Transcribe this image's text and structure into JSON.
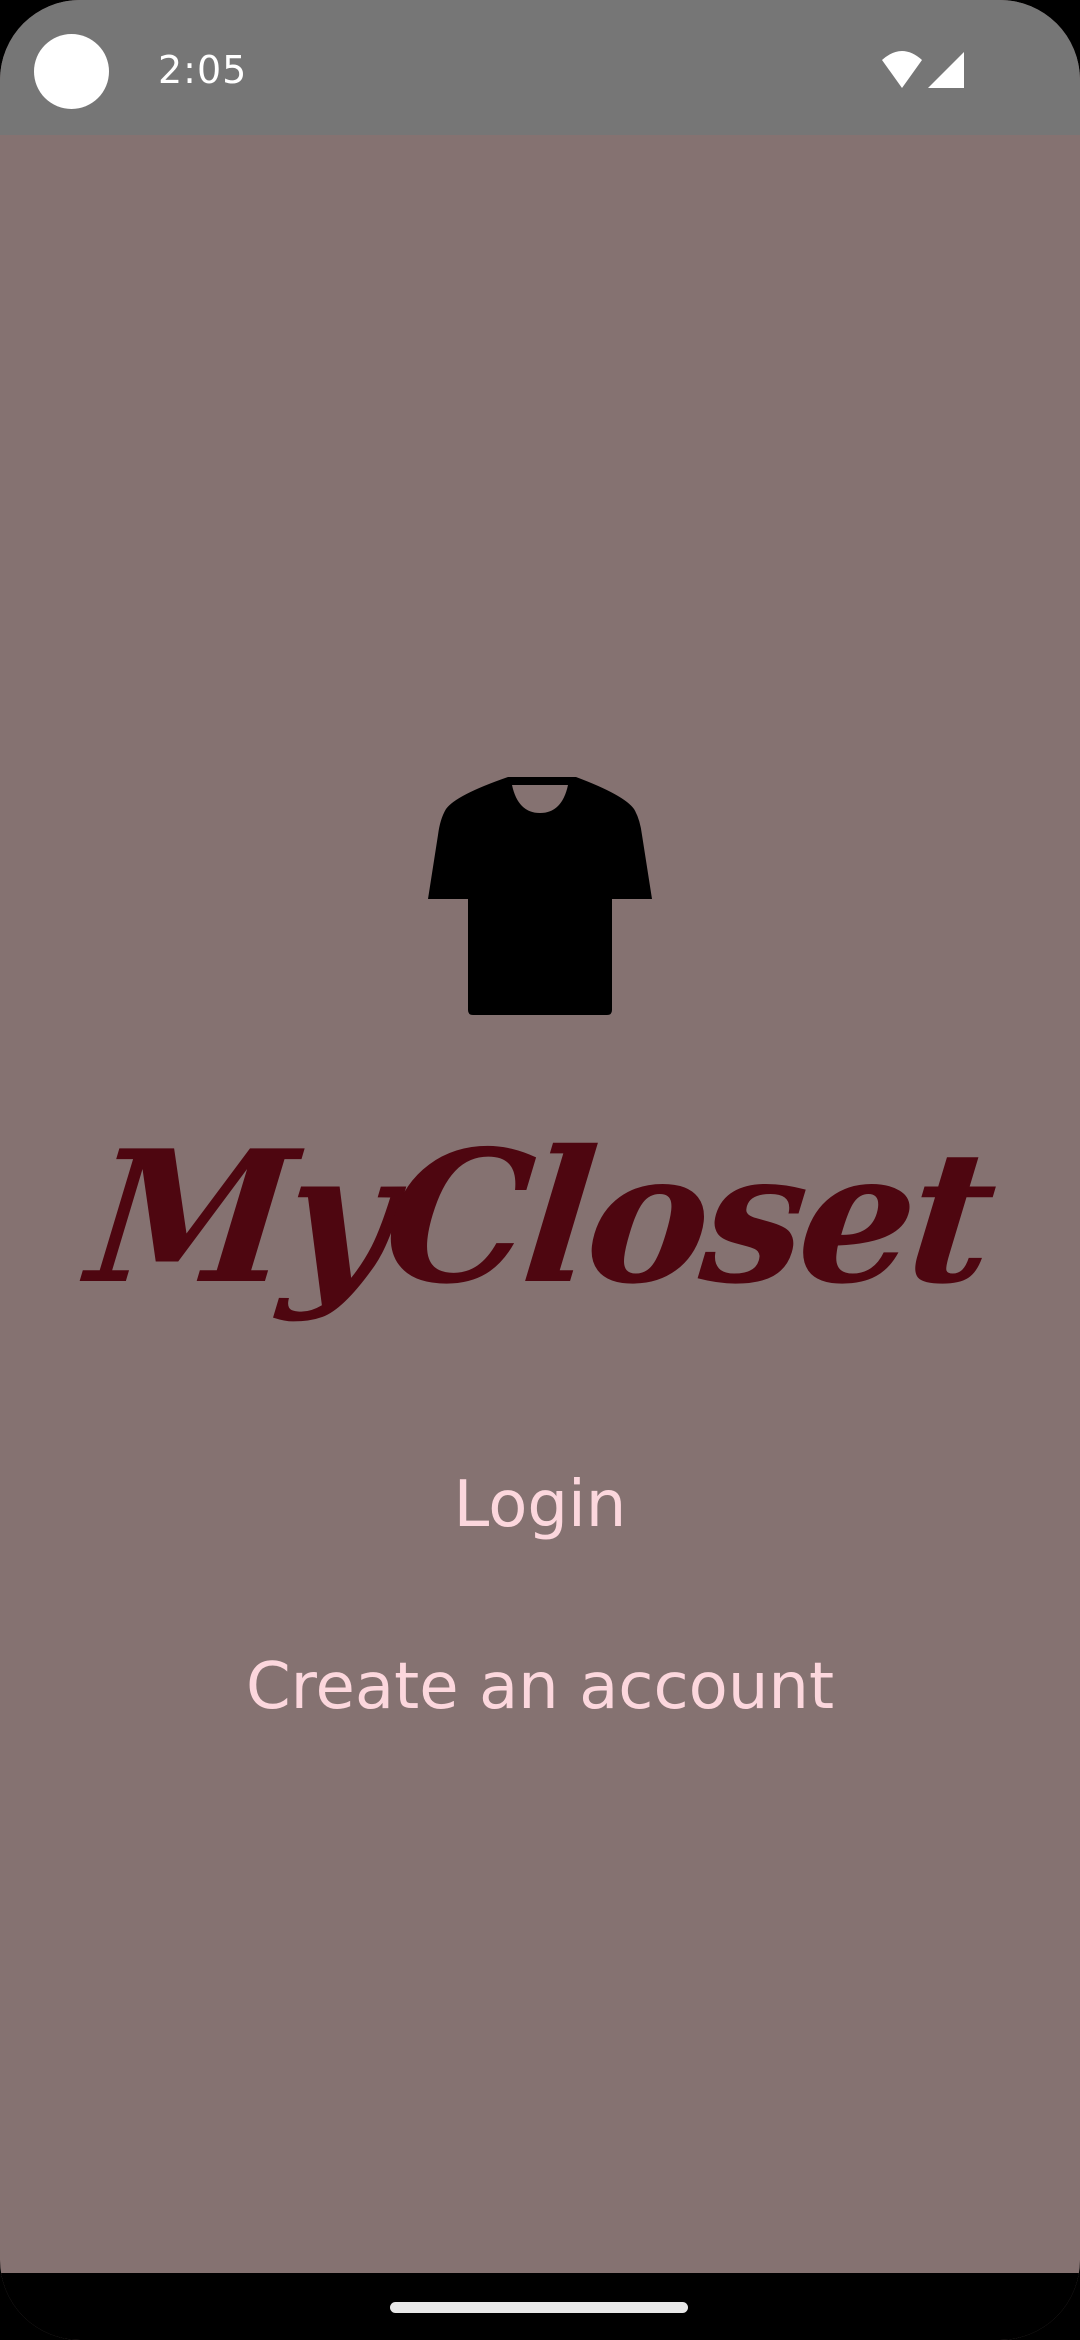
{
  "status_bar": {
    "time": "2:05",
    "icons": [
      "wifi-icon",
      "signal-icon"
    ],
    "background": "#767676"
  },
  "app": {
    "logo_icon": "t-shirt-icon",
    "title": "MyCloset",
    "title_color": "#4e0610",
    "background": "#857271"
  },
  "actions": {
    "login_label": "Login",
    "create_account_label": "Create an account",
    "label_color": "#fcd7dd"
  },
  "nav": {
    "home_indicator": "home-gesture-handle"
  }
}
